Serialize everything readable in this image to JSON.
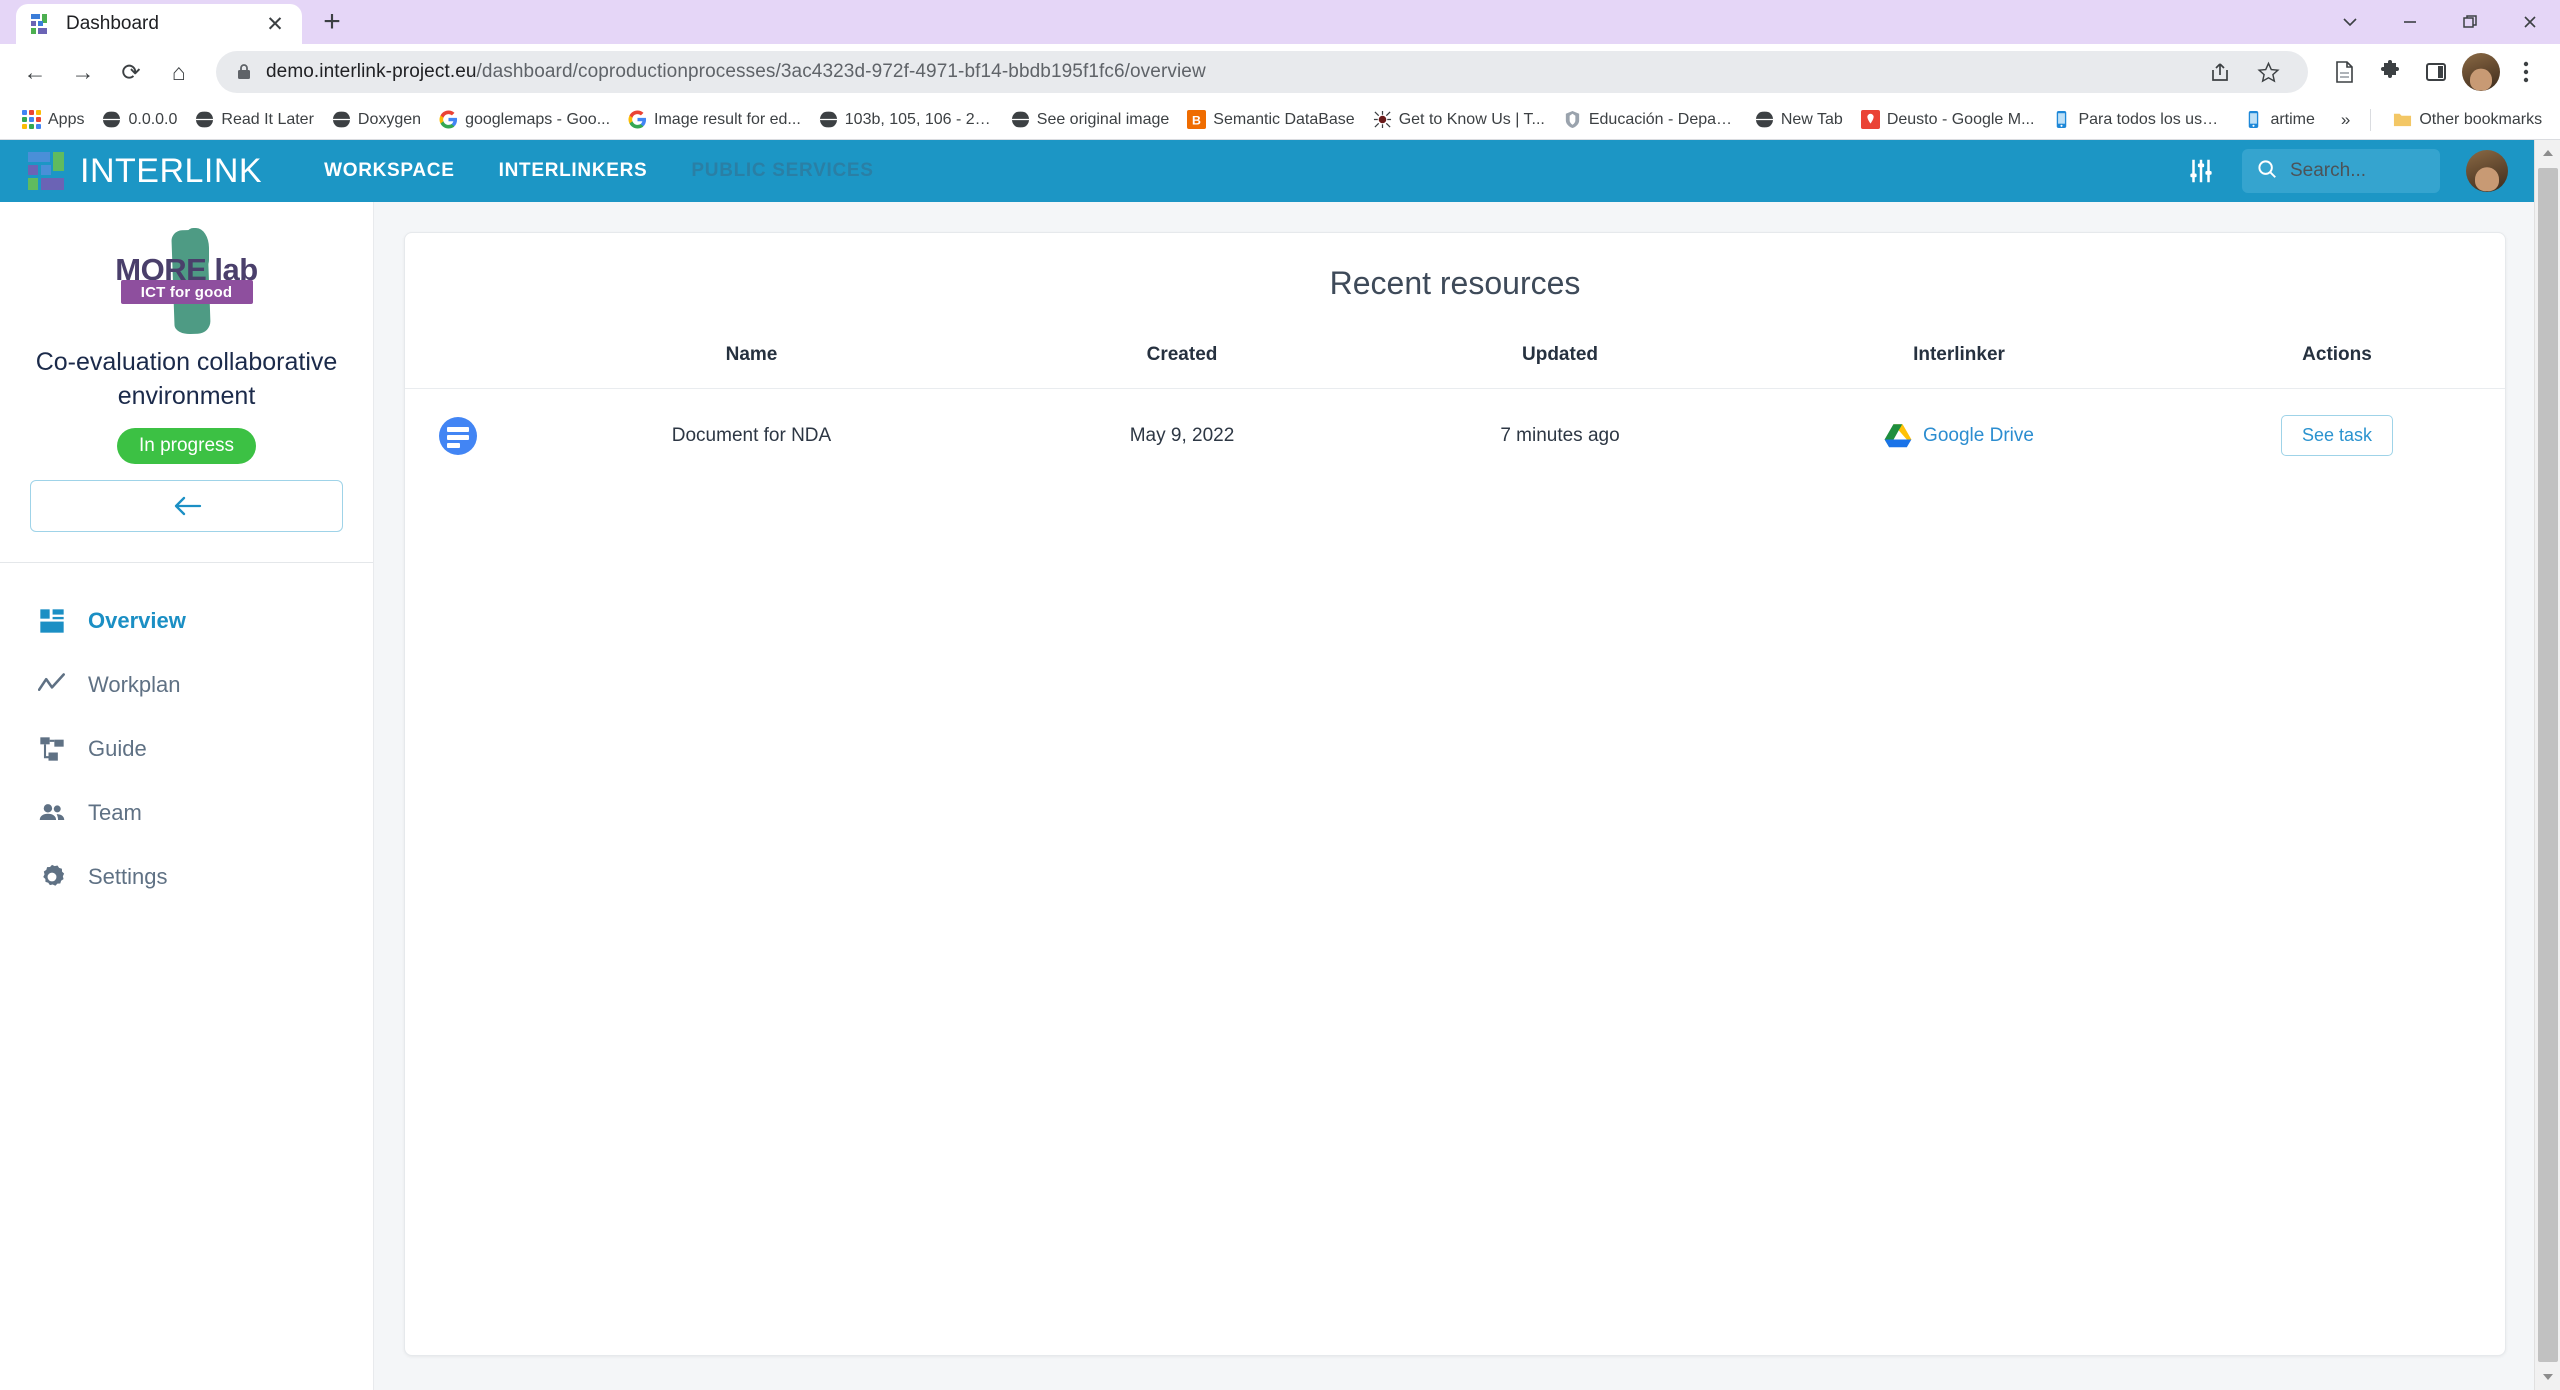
{
  "browser": {
    "tab": {
      "title": "Dashboard",
      "favicon": "interlink-favicon",
      "close_label": "✕"
    },
    "new_tab_label": "+",
    "window_controls": [
      {
        "name": "tab-search",
        "glyph": "⌄"
      },
      {
        "name": "minimize",
        "glyph": "—"
      },
      {
        "name": "maximize",
        "glyph": "❐"
      },
      {
        "name": "close",
        "glyph": "✕"
      }
    ],
    "nav": {
      "back": "←",
      "forward": "→",
      "reload": "⟳",
      "home": "⌂"
    },
    "url": {
      "domain": "demo.interlink-project.eu",
      "path": "/dashboard/coproductionprocesses/3ac4323d-972f-4971-bf14-bbdb195f1fc6/overview",
      "full": "demo.interlink-project.eu/dashboard/coproductionprocesses/3ac4323d-972f-4971-bf14-bbdb195f1fc6/overview"
    },
    "toolbar_icons": [
      "share-icon",
      "bookmark-star-icon",
      "reading-list-icon",
      "extensions-puzzle-icon",
      "side-panel-icon",
      "profile-avatar",
      "chrome-menu-icon"
    ],
    "bookmarks": [
      {
        "label": "Apps",
        "icon": "apps-grid-icon"
      },
      {
        "label": "0.0.0.0",
        "icon": "globe-icon"
      },
      {
        "label": "Read It Later",
        "icon": "globe-icon"
      },
      {
        "label": "Doxygen",
        "icon": "globe-icon"
      },
      {
        "label": "googlemaps - Goo...",
        "icon": "google-g-icon"
      },
      {
        "label": "Image result for ed...",
        "icon": "google-g-icon"
      },
      {
        "label": "103b, 105, 106 - 22...",
        "icon": "globe-icon"
      },
      {
        "label": "See original image",
        "icon": "globe-icon"
      },
      {
        "label": "Semantic DataBase",
        "icon": "orange-b-icon"
      },
      {
        "label": "Get to Know Us | T...",
        "icon": "spider-icon"
      },
      {
        "label": "Educación - Depart...",
        "icon": "crest-icon"
      },
      {
        "label": "New Tab",
        "icon": "globe-icon"
      },
      {
        "label": "Deusto - Google M...",
        "icon": "map-pin-icon"
      },
      {
        "label": "Para todos los usua...",
        "icon": "phone-icon"
      },
      {
        "label": "artime",
        "icon": "phone-icon"
      }
    ],
    "bookmarks_overflow": "»",
    "other_bookmarks": {
      "label": "Other bookmarks",
      "icon": "folder-icon"
    }
  },
  "app": {
    "brand": "INTERLINK",
    "nav": [
      {
        "label": "WORKSPACE",
        "active": true
      },
      {
        "label": "INTERLINKERS",
        "active": true
      },
      {
        "label": "PUBLIC SERVICES",
        "active": false
      }
    ],
    "filter_icon": "sliders-icon",
    "search": {
      "placeholder": "Search...",
      "icon": "search-icon"
    },
    "avatar": "user-avatar",
    "accent_color": "#1c96c5"
  },
  "sidebar": {
    "logo": {
      "name": "MORE lab",
      "tagline": "ICT for good"
    },
    "process_title": "Co-evaluation collaborative environment",
    "status": {
      "label": "In progress",
      "color": "#3cc144"
    },
    "back_button": {
      "icon": "arrow-left-icon"
    },
    "menu": [
      {
        "label": "Overview",
        "icon": "dashboard-grid-icon",
        "active": true
      },
      {
        "label": "Workplan",
        "icon": "trend-line-icon",
        "active": false
      },
      {
        "label": "Guide",
        "icon": "sitemap-icon",
        "active": false
      },
      {
        "label": "Team",
        "icon": "people-icon",
        "active": false
      },
      {
        "label": "Settings",
        "icon": "gear-icon",
        "active": false
      }
    ]
  },
  "main": {
    "card_title": "Recent resources",
    "columns": [
      "",
      "Name",
      "Created",
      "Updated",
      "Interlinker",
      "Actions"
    ],
    "rows": [
      {
        "icon": "document-circle-icon",
        "name": "Document for NDA",
        "created": "May 9, 2022",
        "updated": "7 minutes ago",
        "interlinker": {
          "label": "Google Drive",
          "icon": "google-drive-icon"
        },
        "action": "See task"
      }
    ]
  },
  "scrollbar": {
    "up": "▴",
    "down": "▾"
  }
}
